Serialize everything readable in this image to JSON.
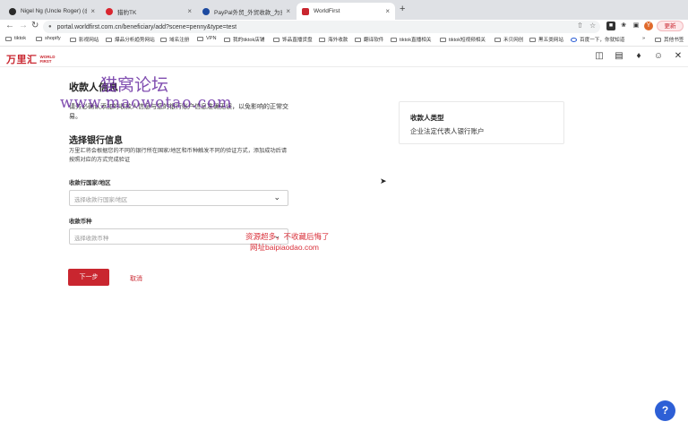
{
  "browser": {
    "tabs": [
      {
        "title": "Nigel Ng (Uncle Roger) (@mr",
        "fav_color": "#2b2b2b"
      },
      {
        "title": "猎豹TK",
        "fav_color": "#d9262f"
      },
      {
        "title": "PayPal外贸_外贸收款_为卖家提",
        "fav_color": "#1d4aa0"
      },
      {
        "title": "WorldFirst",
        "fav_color": "#c9262f"
      }
    ],
    "url": "portal.worldfirst.com.cn/beneficiary/add?scene=penny&type=test",
    "update_label": "更新",
    "profile_initial": "Y",
    "bookmarks": [
      "tiktok",
      "shopify",
      "影视网站",
      "爆品分析趋势网站",
      "域名注册",
      "VPN",
      "我的tiktok店铺",
      "饰品直播货盘",
      "海外收款",
      "翻译软件",
      "tiktok直播相关",
      "tiktok短视频相关",
      "禾贝网创",
      "黑五类网站",
      "百度一下，你就知道",
      "其他书签"
    ],
    "more_bookmarks": "»"
  },
  "app": {
    "logo_cn": "万里汇",
    "logo_en_line1": "WORLD",
    "logo_en_line2": "FIRST",
    "header_icons": [
      "inbox-icon",
      "gift-icon",
      "bell-icon",
      "user-icon",
      "close-icon"
    ]
  },
  "page": {
    "title": "收款人信息",
    "description": "请务必确认添加的收款人信息与您的银行账户信息准确无误，以免影响的正常交易。",
    "bank_section_title": "选择银行信息",
    "bank_section_desc": "万里汇将会根据您的不同的银行所在国家/地区和币种触发不同的验证方式，添加成功后请按照对应的方式完成验证",
    "country_label": "收款行国家/地区",
    "country_placeholder": "选择收款行国家/地区",
    "currency_label": "收款币种",
    "currency_placeholder": "选择收款币种",
    "next_label": "下一步",
    "cancel_label": "取消"
  },
  "side_card": {
    "label": "收款人类型",
    "value": "企业法定代表人银行账户"
  },
  "help_label": "?",
  "watermarks": {
    "line1": "猫窝论坛",
    "line2": "www.maowotao.com",
    "line3": "资源超多，不收藏后悔了",
    "line4": "网址baipiaodao.com"
  },
  "colors": {
    "brand": "#c9262f",
    "help": "#2d5fd6"
  }
}
